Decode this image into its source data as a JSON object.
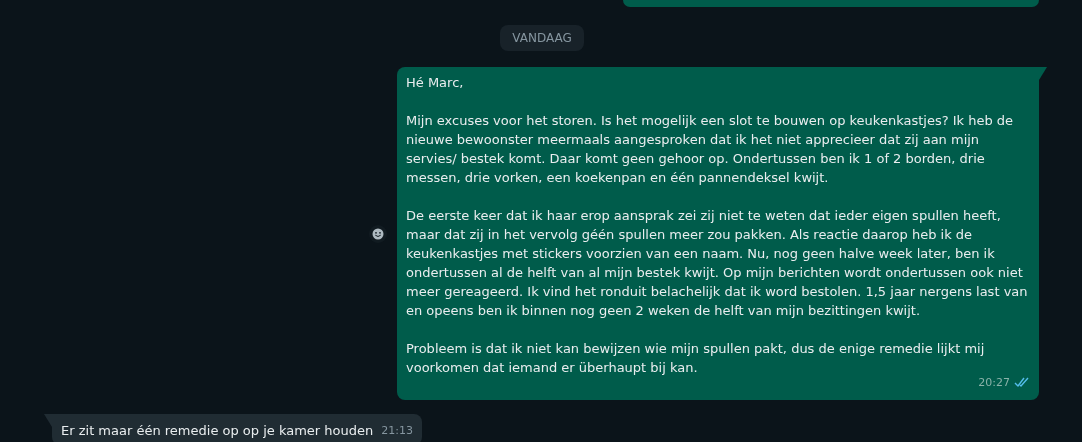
{
  "date_chip": "VANDAAG",
  "messages": [
    {
      "kind": "out",
      "paragraphs": [
        "Hé Marc,",
        "Mijn excuses voor het storen. Is het mogelijk een slot te bouwen op keukenkastjes? Ik heb de nieuwe bewoonster meermaals aangesproken dat ik het niet apprecieer dat zij aan mijn servies/ bestek komt. Daar komt geen gehoor op. Ondertussen ben ik 1 of 2 borden, drie messen, drie vorken, een koekenpan en één pannendeksel kwijt.",
        "De eerste keer dat ik haar erop aansprak zei zij niet te weten dat ieder eigen spullen heeft, maar dat zij in het vervolg géén spullen meer zou pakken. Als reactie daarop heb ik de keukenkastjes met stickers voorzien van een naam. Nu, nog geen halve week later, ben ik ondertussen al de helft van al mijn bestek kwijt. Op mijn berichten wordt ondertussen ook niet meer gereageerd. Ik vind het ronduit belachelijk dat ik word bestolen. 1,5 jaar nergens last van en opeens ben ik binnen nog geen 2 weken de helft van mijn bezittingen kwijt.",
        "Probleem is dat ik niet kan bewijzen wie mijn spullen pakt, dus de enige remedie lijkt mij voorkomen dat iemand er überhaupt bij kan."
      ],
      "time": "20:27",
      "read": true
    },
    {
      "kind": "in",
      "paragraphs": [
        "Er zit maar één remedie op op je kamer houden"
      ],
      "time": "21:13"
    }
  ]
}
